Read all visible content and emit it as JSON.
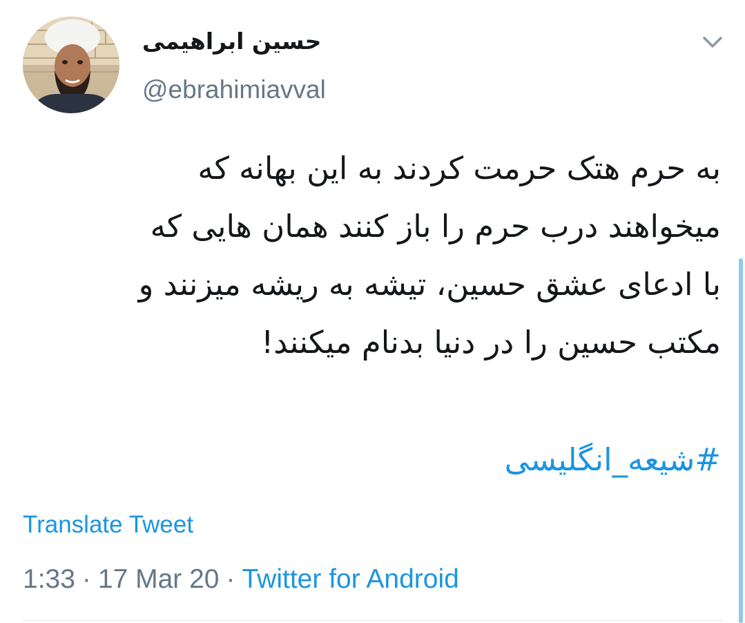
{
  "author": {
    "display_name": "حسین ابراهیمی",
    "handle": "@ebrahimiavval",
    "avatar_icon": "user-avatar"
  },
  "tweet": {
    "lines": [
      "به حرم هتک حرمت کردند به این بهانه که",
      "میخواهند درب حرم را باز کنند همان هایی که",
      "با ادعای عشق حسین، تیشه به ریشه میزنند و",
      "مکتب حسین را در دنیا بدنام میکنند!"
    ],
    "hashtag": "#شیعه_انگلیسی"
  },
  "actions": {
    "translate_label": "Translate Tweet",
    "menu_icon": "chevron-down-icon"
  },
  "meta": {
    "time": "1:33",
    "separator": "·",
    "date": "17 Mar 20",
    "source": "Twitter for Android"
  },
  "colors": {
    "link": "#1b95e0",
    "muted": "#657786",
    "text": "#14171a",
    "divider": "#e1e8ed"
  }
}
